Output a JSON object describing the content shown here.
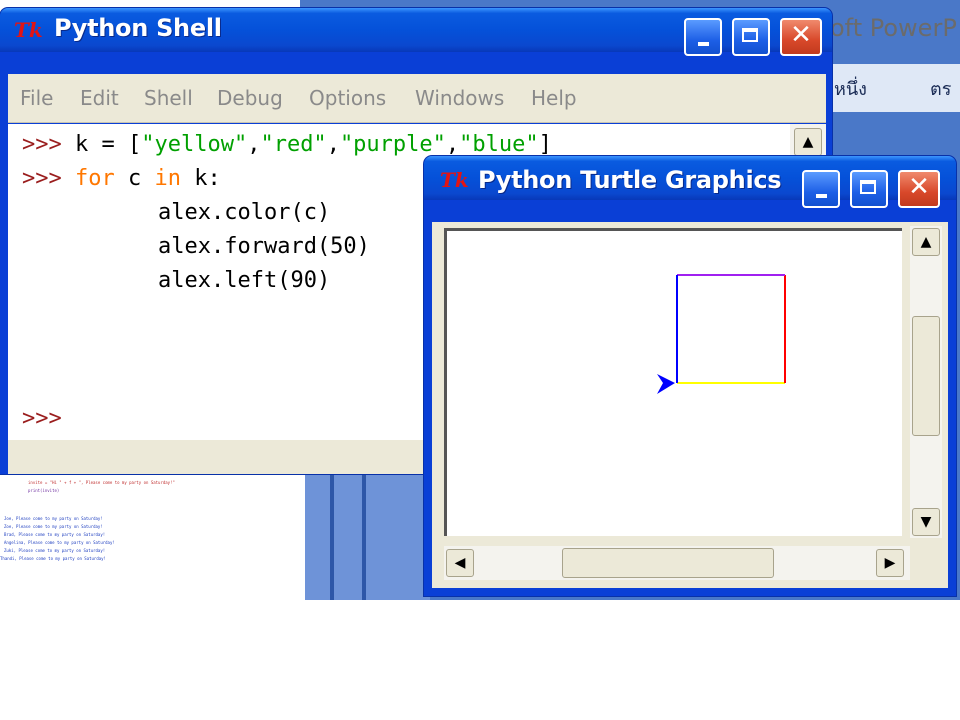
{
  "background": {
    "ppt_title": "oft PowerP",
    "ppt_menu": [
      "หนึ่ง",
      "ตร"
    ],
    "code_snippet_lines": [
      "  invite = \"Hi \" + f + \", Please come to my party on Saturday!\"",
      "  print(invite)",
      "Joe, Please come to my party on Saturday!",
      "Zoe, Please come to my party on Saturday!",
      "Brad, Please come to my party on Saturday!",
      "Angelina, Please come to my party on Saturday!",
      "Zuki, Please come to my party on Saturday!",
      "Thandi, Please come to my party on Saturday!"
    ]
  },
  "shell": {
    "logo": "Tk",
    "title": "Python Shell",
    "menus": [
      "File",
      "Edit",
      "Shell",
      "Debug",
      "Options",
      "Windows",
      "Help"
    ],
    "lines": {
      "l1_prompt": ">>>",
      "l1_a": "k = [",
      "l1_s1": "\"yellow\"",
      "l1_c1": ",",
      "l1_s2": "\"red\"",
      "l1_c2": ",",
      "l1_s3": "\"purple\"",
      "l1_c3": ",",
      "l1_s4": "\"blue\"",
      "l1_end": "]",
      "l2_prompt": ">>>",
      "l2_for": "for",
      "l2_c": " c ",
      "l2_in": "in",
      "l2_k": " k:",
      "l3": "alex.color(c)",
      "l4": "alex.forward(50)",
      "l5": "alex.left(90)",
      "l6_prompt": ">>>"
    }
  },
  "turtle": {
    "logo": "Tk",
    "title": "Python Turtle Graphics",
    "square_colors": [
      "#ffff00",
      "#ff0000",
      "#a020f0",
      "#0000ff"
    ],
    "turtle_color": "#0000ff"
  },
  "glyphs": {
    "up": "▲",
    "down": "▼",
    "left": "◀",
    "right": "▶",
    "close": "✕"
  }
}
